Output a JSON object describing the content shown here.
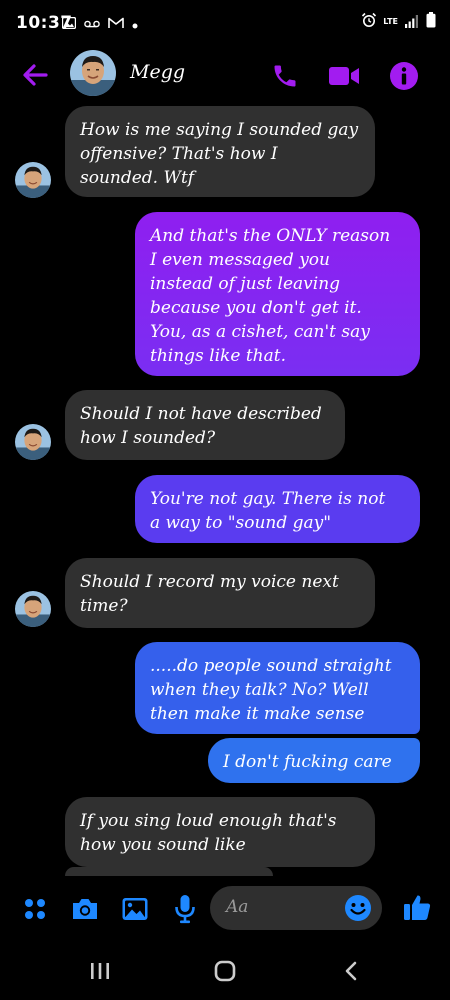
{
  "status_bar": {
    "time": "10:37",
    "network": "LTE",
    "icons": [
      "gallery-icon",
      "voicemail-icon",
      "gmail-icon",
      "dot-icon",
      "alarm-icon",
      "signal-icon",
      "battery-icon"
    ]
  },
  "header": {
    "contact_name": "Megg",
    "accent_color": "#a21cf0",
    "icons": [
      "back-arrow-icon",
      "phone-icon",
      "video-icon",
      "info-icon"
    ]
  },
  "messages": [
    {
      "from": "them",
      "text": "How is me saying I sounded gay\noffensive? That's how I\nsounded. Wtf"
    },
    {
      "from": "me",
      "text": "And that's the ONLY reason\nI even messaged you\ninstead of just leaving\nbecause you don't get it.\nYou, as a cishet, can't say\nthings like that."
    },
    {
      "from": "them",
      "text": "Should I not have described\nhow I sounded?"
    },
    {
      "from": "me",
      "text": "You're not gay. There is not\na way to \"sound gay\""
    },
    {
      "from": "them",
      "text": "Should I record my voice next\ntime?"
    },
    {
      "from": "me",
      "text": ".....do people sound straight\nwhen they talk? No? Well\nthen make it make sense"
    },
    {
      "from": "me",
      "text": "I don't fucking care"
    },
    {
      "from": "them",
      "text": "If you sing loud enough that's\nhow you sound like"
    }
  ],
  "composer": {
    "placeholder": "Aa",
    "accent_color": "#1e88ff",
    "icons": [
      "apps-grid-icon",
      "camera-icon",
      "image-icon",
      "microphone-icon",
      "emoji-icon",
      "thumbs-up-icon"
    ]
  },
  "nav_bar": {
    "icons": [
      "recent-apps-icon",
      "home-icon",
      "back-icon"
    ]
  }
}
